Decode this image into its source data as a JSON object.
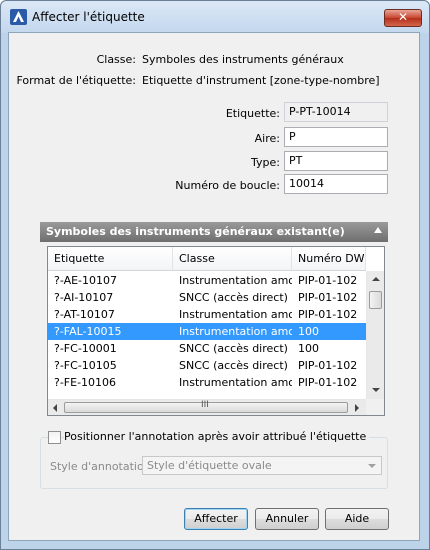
{
  "window": {
    "title": "Affecter l'étiquette",
    "close_glyph": "✕"
  },
  "info": {
    "class_label": "Classe:",
    "class_value": "Symboles des instruments généraux",
    "format_label": "Format de l'étiquette:",
    "format_value": "Etiquette d'instrument [zone-type-nombre]"
  },
  "form": {
    "tag_label": "Etiquette:",
    "tag_value": "P-PT-10014",
    "area_label": "Aire:",
    "area_value": "P",
    "type_label": "Type:",
    "type_value": "PT",
    "loop_label": "Numéro de boucle:",
    "loop_value": "10014"
  },
  "existing": {
    "header": "Symboles des instruments généraux existant(e)",
    "columns": [
      "Etiquette",
      "Classe",
      "Numéro DWG"
    ],
    "rows": [
      [
        "?-AE-10107",
        "Instrumentation amo...",
        "PIP-01-102"
      ],
      [
        "?-AI-10107",
        "SNCC (accès direct)",
        "PIP-01-102"
      ],
      [
        "?-AT-10107",
        "Instrumentation amo...",
        "PIP-01-102"
      ],
      [
        "?-FAL-10015",
        "Instrumentation amo...",
        "100"
      ],
      [
        "?-FC-10001",
        "SNCC (accès direct)",
        "100"
      ],
      [
        "?-FC-10105",
        "SNCC (accès direct)",
        "PIP-01-102"
      ],
      [
        "?-FE-10106",
        "Instrumentation amo...",
        "PIP-01-102"
      ]
    ],
    "selected_index": 3,
    "hscroll_grip": "III"
  },
  "annotation": {
    "checkbox_label": "Positionner l'annotation après avoir attribué l'étiquette",
    "style_label": "Style d'annotation:",
    "style_value": "Style d'étiquette ovale"
  },
  "buttons": {
    "assign": "Affecter",
    "cancel": "Annuler",
    "help": "Aide"
  },
  "colors": {
    "selection": "#3399ff",
    "close": "#c8452f"
  }
}
